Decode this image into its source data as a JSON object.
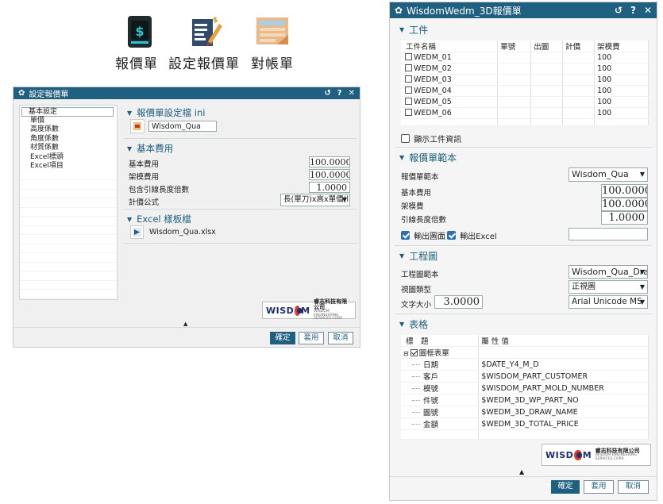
{
  "toolbar": {
    "items": [
      {
        "label": "報價單",
        "icon": "quote-document-icon"
      },
      {
        "label": "設定報價單",
        "icon": "edit-quote-settings-icon"
      },
      {
        "label": "對帳單",
        "icon": "statement-icon"
      }
    ]
  },
  "dialog1": {
    "title": "設定報價單",
    "controls": [
      "↺",
      "?",
      "✕"
    ],
    "nav_items": [
      "基本設定",
      "單價",
      "高度係數",
      "角度係數",
      "材質係數",
      "Excel標頭",
      "Excel項目"
    ],
    "section_template": {
      "label": "報價單設定檔 ini",
      "file": "Wisdom_Qua"
    },
    "section_basic": {
      "label": "基本費用",
      "rows": [
        {
          "label": "基本費用",
          "value": "100.0000"
        },
        {
          "label": "架模費用",
          "value": "100.0000"
        },
        {
          "label": "包含引線長度倍數",
          "value": "1.0000"
        }
      ],
      "formula_label": "計價公式",
      "formula_value": "長(單刀)x高x單價(l"
    },
    "section_excel": {
      "label": "Excel 樣板檔",
      "file": "Wisdom_Qua.xlsx"
    },
    "buttons": {
      "ok": "確定",
      "apply": "套用",
      "cancel": "取消"
    },
    "logo": {
      "brand_a": "WISD",
      "brand_b": "M",
      "company": "睿志科技有限公司",
      "company_en": "WISDOM ENGINEERING SERVICES CORP."
    }
  },
  "dialog2": {
    "title": "WisdomWedm_3D報價單",
    "controls": [
      "↺",
      "?",
      "✕"
    ],
    "workpiece": {
      "label": "工件",
      "columns": [
        "工件名稱",
        "單號",
        "出圖",
        "計價",
        "架模費"
      ],
      "rows": [
        {
          "name": "WEDM_01",
          "fee": "100"
        },
        {
          "name": "WEDM_02",
          "fee": "100"
        },
        {
          "name": "WEDM_03",
          "fee": "100"
        },
        {
          "name": "WEDM_04",
          "fee": "100"
        },
        {
          "name": "WEDM_05",
          "fee": "100"
        },
        {
          "name": "WEDM_06",
          "fee": "100"
        }
      ],
      "show_info": "顯示工件資訊"
    },
    "template": {
      "label": "報價單範本",
      "template_label": "報價單範本",
      "template_value": "Wisdom_Qua",
      "rows": [
        {
          "label": "基本費用",
          "value": "100.0000"
        },
        {
          "label": "架模費",
          "value": "100.0000"
        },
        {
          "label": "引線長度倍數",
          "value": "1.0000"
        }
      ],
      "output_view": "輸出圖面",
      "output_excel": "輸出Excel",
      "output_path": ""
    },
    "drawing": {
      "label": "工程圖",
      "rows": [
        {
          "label": "工程圖範本",
          "value": "Wisdom_Qua_Dra"
        },
        {
          "label": "視圖類型",
          "value": "正視圖"
        }
      ],
      "text_size_label": "文字大小",
      "text_size_value": "3.0000",
      "font_value": "Arial Unicode MS"
    },
    "table": {
      "label": "表格",
      "col_title": "標　題",
      "col_value": "屬 性 值",
      "group": "圖框表單",
      "rows": [
        {
          "title": "日期",
          "value": "$DATE_Y4_M_D"
        },
        {
          "title": "客戶",
          "value": "$WISDOM_PART_CUSTOMER"
        },
        {
          "title": "模號",
          "value": "$WISDOM_PART_MOLD_NUMBER"
        },
        {
          "title": "件號",
          "value": "$WEDM_3D_WP_PART_NO"
        },
        {
          "title": "圖號",
          "value": "$WEDM_3D_DRAW_NAME"
        },
        {
          "title": "金額",
          "value": "$WEDM_3D_TOTAL_PRICE"
        }
      ]
    },
    "buttons": {
      "ok": "確定",
      "apply": "套用",
      "cancel": "取消"
    },
    "logo": {
      "brand_a": "WISD",
      "brand_b": "M",
      "company": "睿志科技有限公司",
      "company_en": "WISDOM ENGINEERING SERVICES CORP."
    }
  }
}
